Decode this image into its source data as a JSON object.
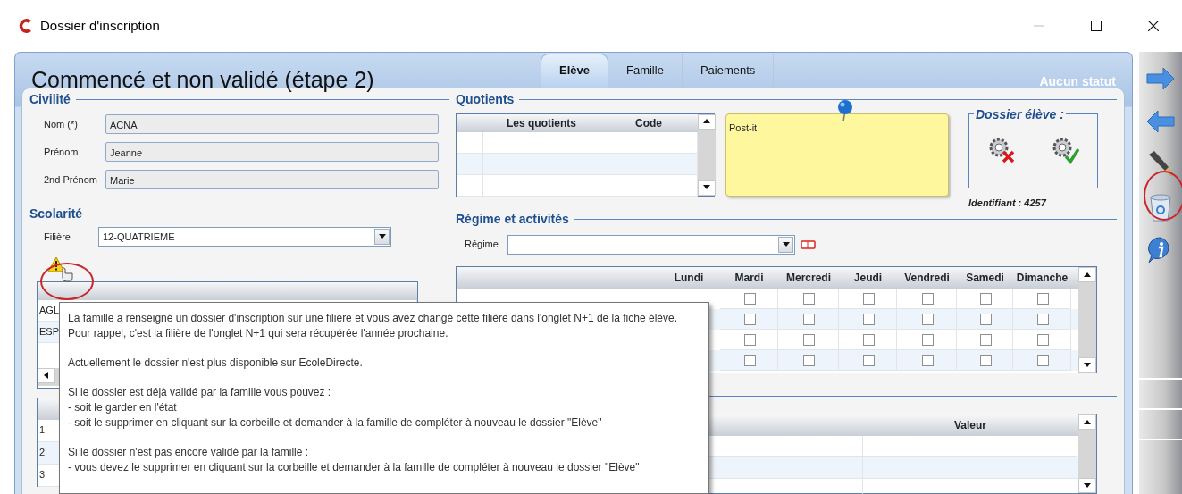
{
  "window": {
    "title": "Dossier d'inscription"
  },
  "header": {
    "title": "Commencé et non validé (étape 2)",
    "status": "Aucun statut"
  },
  "tabs": [
    {
      "label": "Elève",
      "selected": true
    },
    {
      "label": "Famille",
      "selected": false
    },
    {
      "label": "Paiements",
      "selected": false
    }
  ],
  "civilite": {
    "legend": "Civilité",
    "fields": [
      {
        "label": "Nom (*)",
        "value": "ACNA"
      },
      {
        "label": "Prénom",
        "value": "Jeanne"
      },
      {
        "label": "2nd Prénom",
        "value": "Marie"
      }
    ]
  },
  "scolarite": {
    "legend": "Scolarité",
    "filiere": {
      "label": "Filière",
      "value": "12-QUATRIEME"
    },
    "options_rows": [
      "AGL",
      "ESP"
    ],
    "numbered_rows": [
      "1",
      "2",
      "3"
    ]
  },
  "quotients": {
    "legend": "Quotients",
    "columns": [
      "Les quotients",
      "Code"
    ]
  },
  "postit": {
    "text": "Post-it"
  },
  "dossier_eleve": {
    "legend": "Dossier élève :",
    "identifiant": "Identifiant : 4257"
  },
  "regime": {
    "legend": "Régime et activités",
    "label": "Régime"
  },
  "activities": {
    "columns": [
      "Lundi",
      "Mardi",
      "Mercredi",
      "Jeudi",
      "Vendredi",
      "Samedi",
      "Dimanche"
    ],
    "rows": [
      {
        "checks": [
          false,
          false,
          false,
          false,
          false,
          false
        ]
      },
      {
        "checks": [
          false,
          false,
          false,
          false,
          false,
          false
        ]
      },
      {
        "checks": [
          false,
          false,
          false,
          false,
          false,
          false
        ]
      },
      {
        "checks": [
          false,
          false,
          false,
          false,
          false,
          false
        ]
      }
    ]
  },
  "values_table": {
    "columns": [
      "Valeur"
    ]
  },
  "tooltip": {
    "paragraphs": [
      [
        "La famille a renseigné un dossier d'inscription sur une filière et vous avez changé cette filière dans l'onglet N+1 de la fiche élève.",
        "Pour rappel, c'est la filière de l'onglet N+1 qui sera récupérée l'année prochaine."
      ],
      [
        "Actuellement le dossier n'est plus disponible sur EcoleDirecte."
      ],
      [
        "Si le dossier est déjà validé par la famille vous pouvez :",
        "- soit le garder en l'état",
        "- soit le supprimer en cliquant sur la corbeille et demander à la famille de compléter à nouveau le dossier \"Elève\""
      ],
      [
        "Si le dossier n'est pas encore validé par la famille :",
        "- vous devez le supprimer en cliquant sur la corbeille et demander à la famille de compléter à nouveau le dossier \"Elève\""
      ]
    ]
  }
}
